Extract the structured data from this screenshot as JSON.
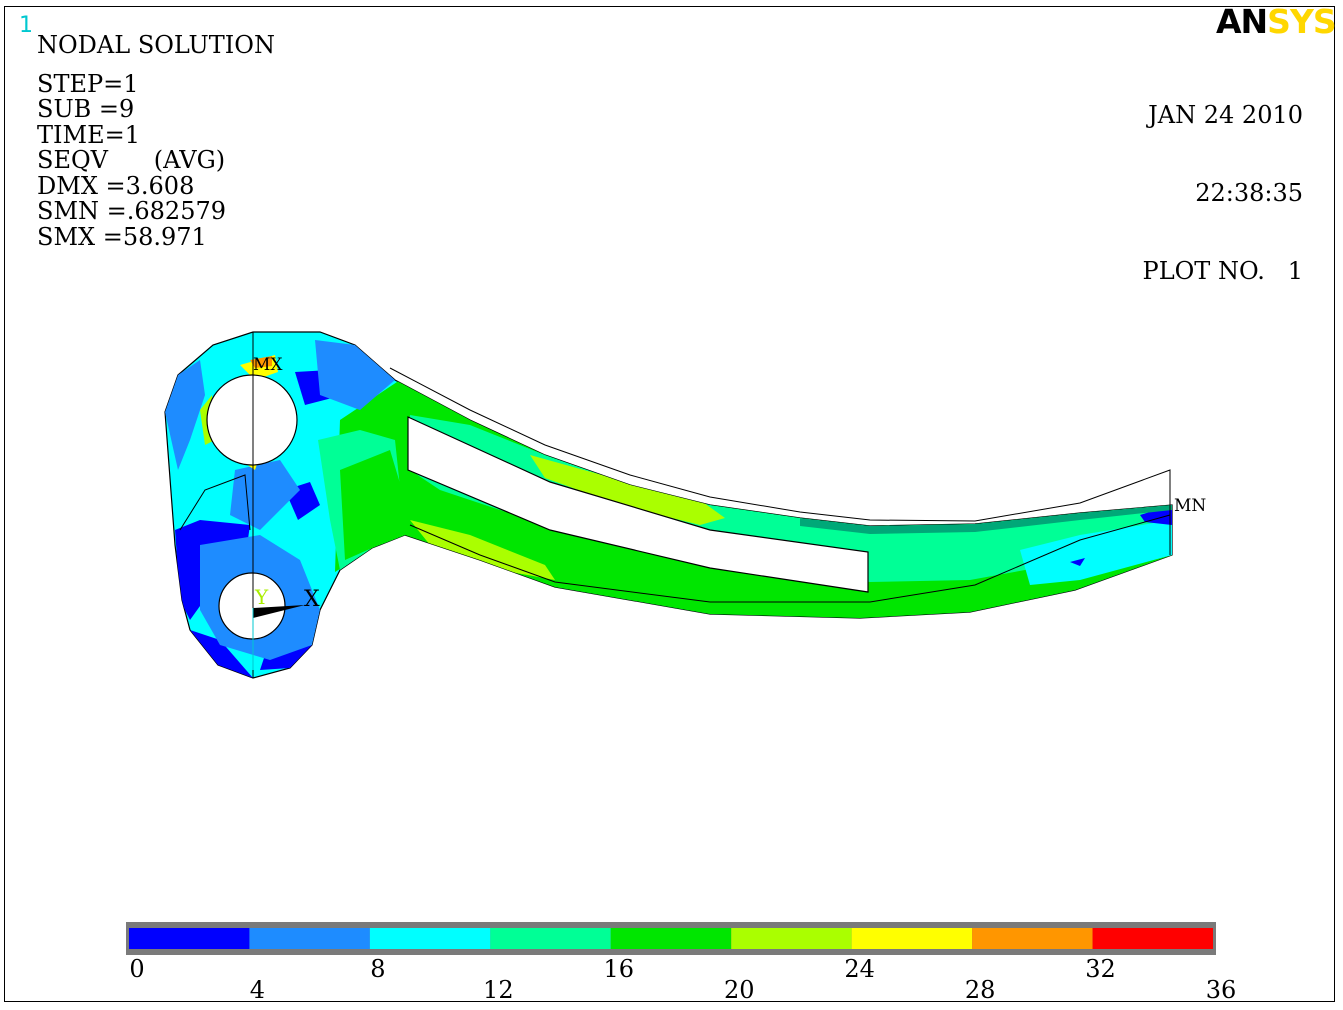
{
  "window_number": "1",
  "info": {
    "title": "NODAL SOLUTION",
    "lines": [
      "STEP=1",
      "SUB =9",
      "TIME=1",
      "SEQV      (AVG)",
      "DMX =3.608",
      "SMN =.682579",
      "SMX =58.971"
    ]
  },
  "logo": {
    "part1": "AN",
    "part2": "SYS",
    "color1": "#000000",
    "color2": "#ffd700"
  },
  "date_block": {
    "date": "JAN 24 2010",
    "time": "22:38:35",
    "plot": "PLOT NO.   1"
  },
  "markers": {
    "max": "MX",
    "min": "MN",
    "axis_x": "X",
    "axis_y": "Y"
  },
  "legend": {
    "colors": [
      "#0000ff",
      "#1e8cff",
      "#00ffff",
      "#00ff96",
      "#00e600",
      "#aaff00",
      "#ffff00",
      "#ff9600",
      "#ff0000"
    ],
    "labels_top": [
      "0",
      "8",
      "16",
      "24",
      "32"
    ],
    "labels_bottom": [
      "4",
      "12",
      "20",
      "28",
      "36"
    ]
  }
}
